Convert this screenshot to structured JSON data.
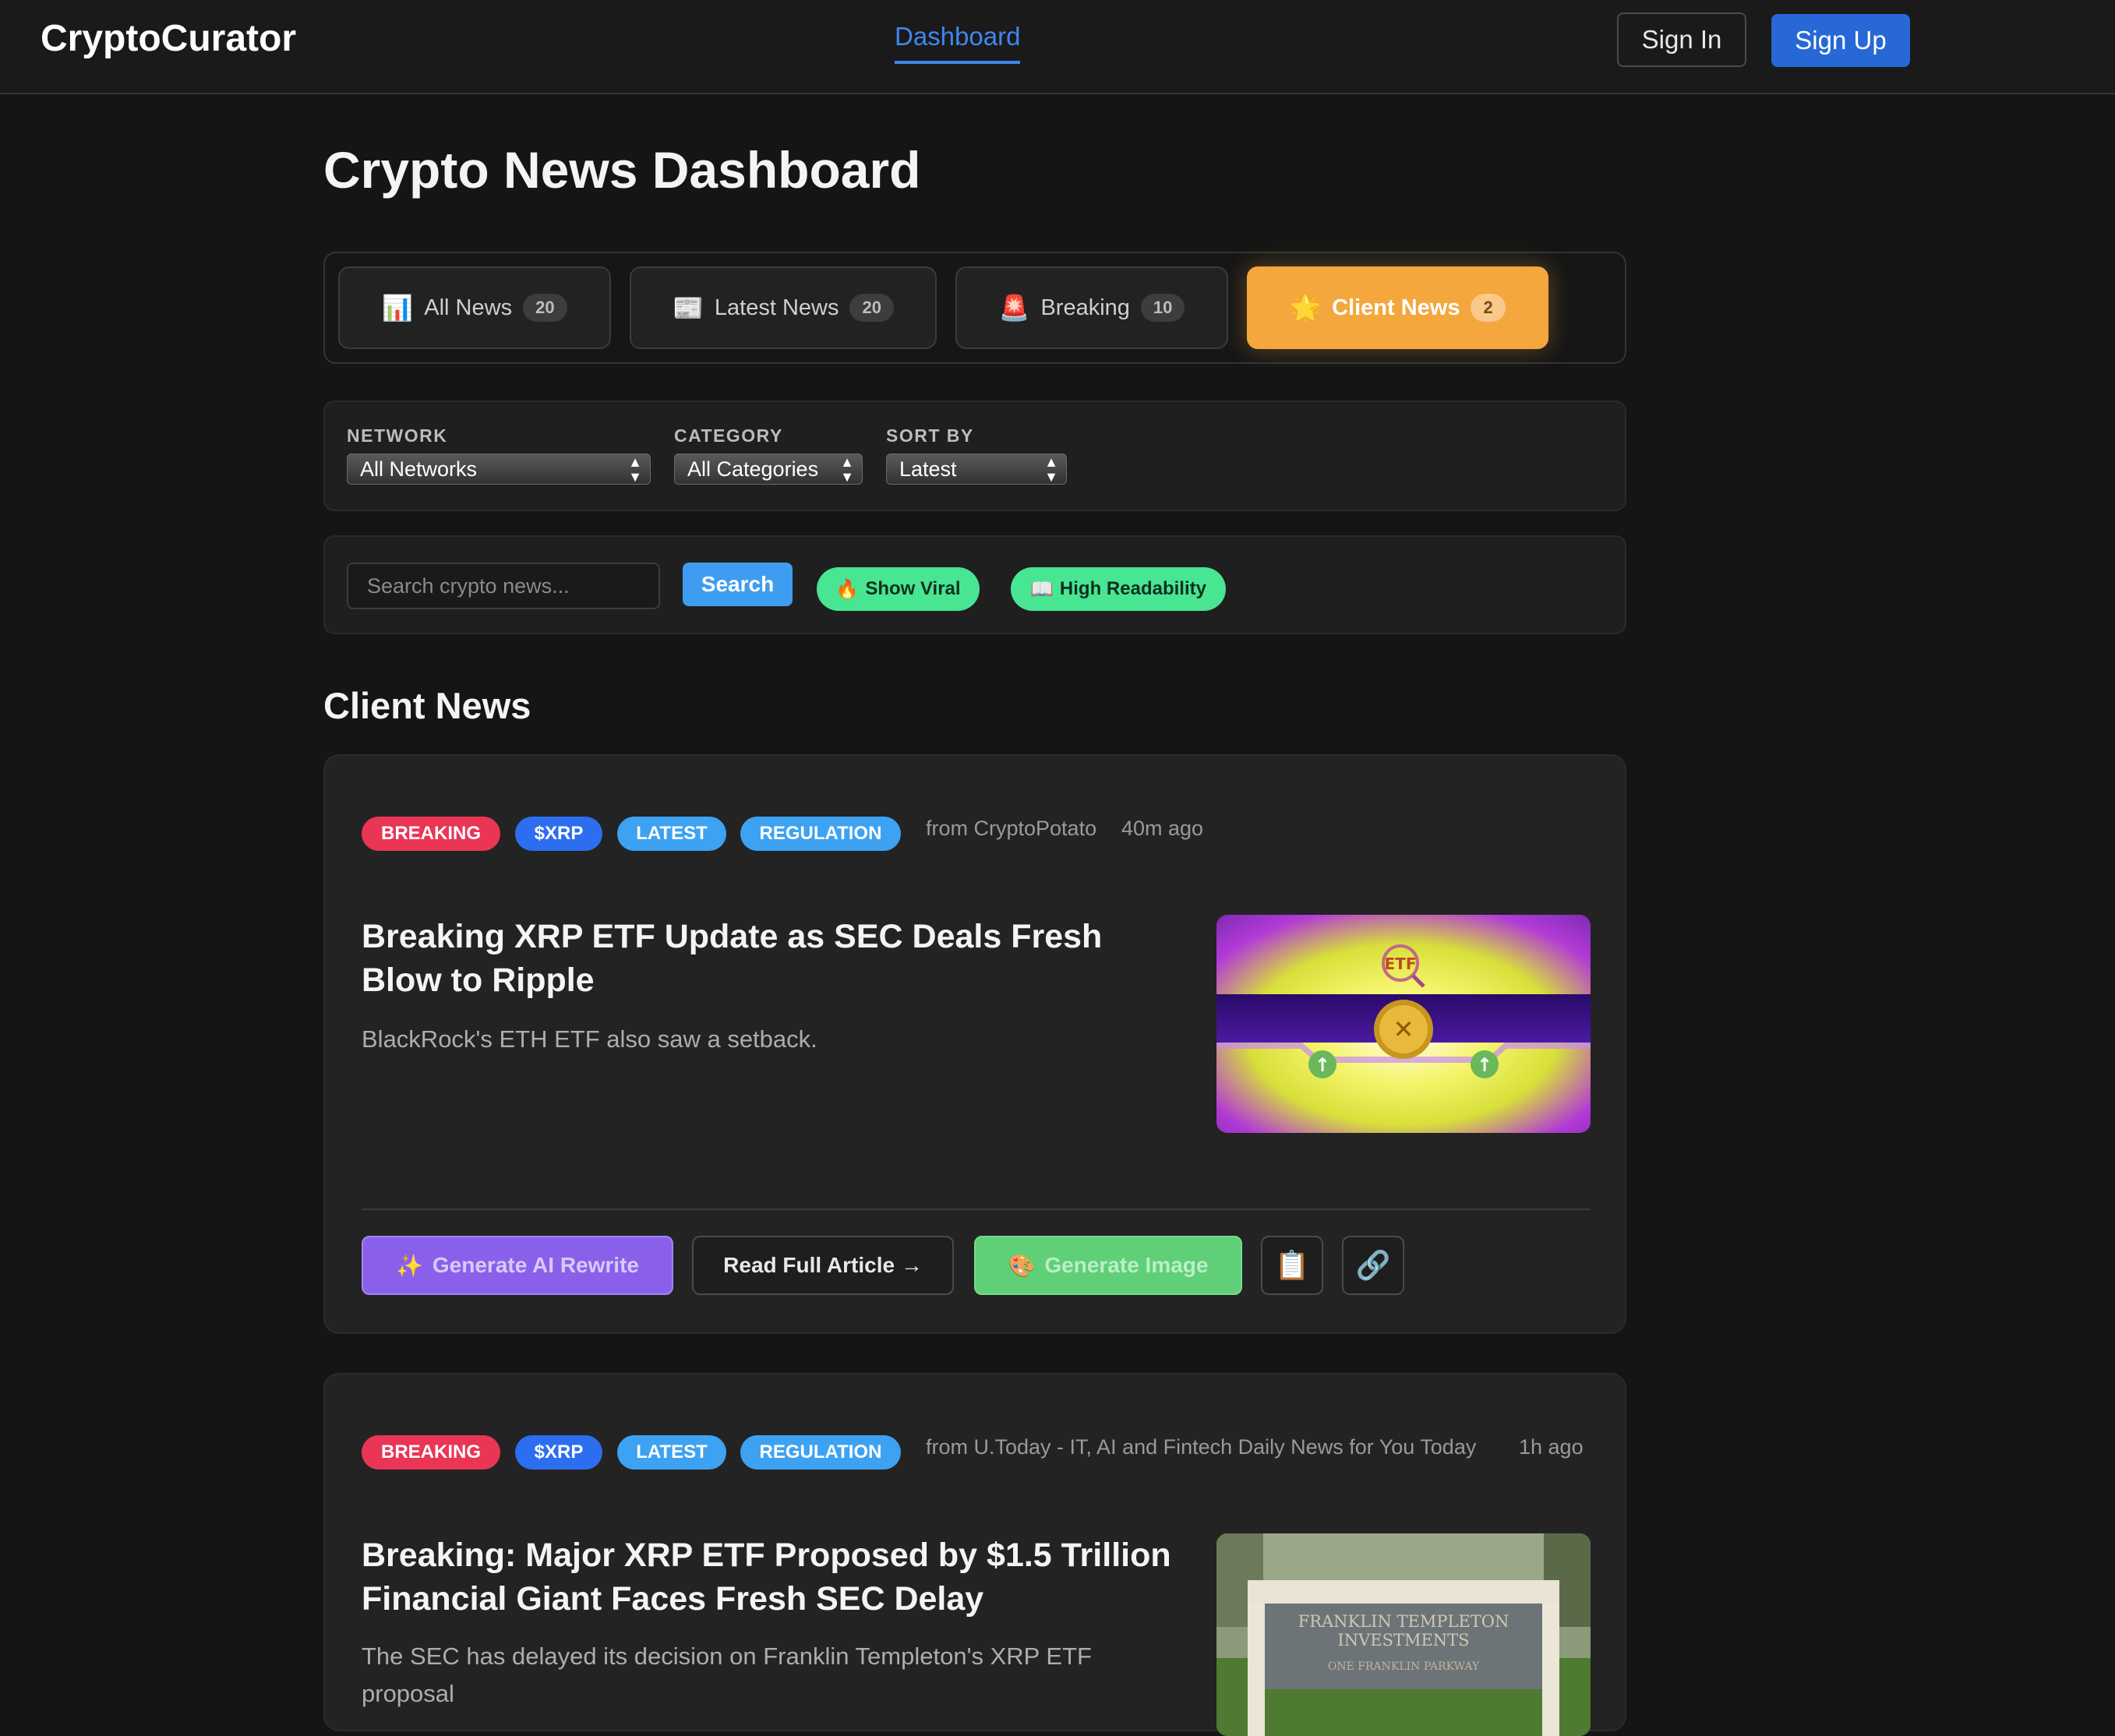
{
  "brand": "CryptoCurator",
  "nav": {
    "dashboard": "Dashboard",
    "sign_in": "Sign In",
    "sign_up": "Sign Up"
  },
  "page_title": "Crypto News Dashboard",
  "tabs": [
    {
      "icon": "📊",
      "icon_name": "bar-chart-icon",
      "label": "All News",
      "count": "20",
      "active": false
    },
    {
      "icon": "📰",
      "icon_name": "newspaper-icon",
      "label": "Latest News",
      "count": "20",
      "active": false
    },
    {
      "icon": "🚨",
      "icon_name": "siren-icon",
      "label": "Breaking",
      "count": "10",
      "active": false
    },
    {
      "icon": "🌟",
      "icon_name": "star-icon",
      "label": "Client News",
      "count": "2",
      "active": true
    }
  ],
  "filters": {
    "network": {
      "label": "NETWORK",
      "value": "All Networks"
    },
    "category": {
      "label": "CATEGORY",
      "value": "All Categories"
    },
    "sort": {
      "label": "SORT BY",
      "value": "Latest"
    }
  },
  "search": {
    "placeholder": "Search crypto news...",
    "button": "Search",
    "viral": {
      "icon": "🔥",
      "label": "Show Viral"
    },
    "readability": {
      "icon": "📖",
      "label": "High Readability"
    }
  },
  "section_title": "Client News",
  "articles": [
    {
      "tags": [
        "BREAKING",
        "$XRP",
        "LATEST",
        "REGULATION"
      ],
      "source": "from CryptoPotato",
      "time": "40m ago",
      "title": "Breaking XRP ETF Update as SEC Deals Fresh Blow to Ripple",
      "description": "BlackRock's ETH ETF also saw a setback.",
      "thumb_text": "ETF"
    },
    {
      "tags": [
        "BREAKING",
        "$XRP",
        "LATEST",
        "REGULATION"
      ],
      "source": "from U.Today - IT, AI and Fintech Daily News for You Today",
      "time": "1h ago",
      "title": "Breaking: Major XRP ETF Proposed by $1.5 Trillion Financial Giant Faces Fresh SEC Delay",
      "description": "The SEC has delayed its decision on Franklin Templeton's XRP ETF proposal",
      "thumb_text": [
        "FRANKLIN TEMPLETON",
        "INVESTMENTS",
        "ONE FRANKLIN PARKWAY"
      ]
    }
  ],
  "actions": {
    "ai_rewrite": {
      "icon": "✨",
      "label": "Generate AI Rewrite"
    },
    "read_full": "Read Full Article →",
    "generate_image": {
      "icon": "🎨",
      "label": "Generate Image"
    },
    "copy_icon": "📋",
    "link_icon": "🔗"
  },
  "colors": {
    "background": "#151515",
    "accent_blue": "#2768d6",
    "active_tab": "#f3a73d",
    "pill_green": "#48e592",
    "tag_breaking": "#ea3555",
    "tag_coin": "#2d6ef0",
    "tag_latest": "#3da2f2"
  }
}
